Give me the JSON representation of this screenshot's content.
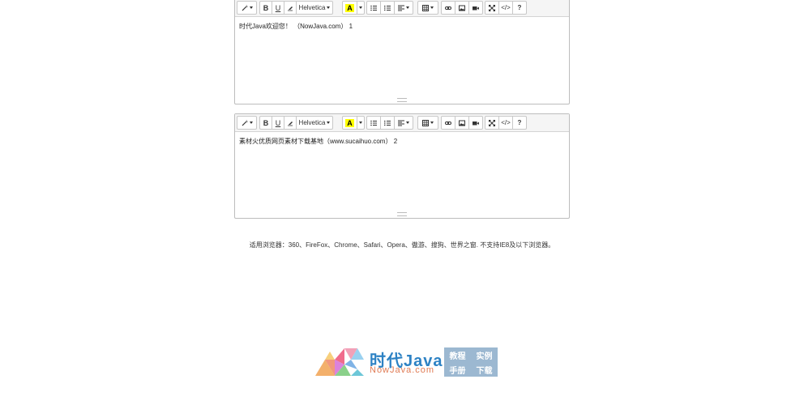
{
  "toolbar": {
    "font_name": "Helvetica",
    "highlight_letter": "A",
    "help_label": "?",
    "bold_label": "B",
    "underline_label": "U",
    "code_label": "</>"
  },
  "editors": [
    {
      "content": "时代Java欢迎您！ （NowJava.com） 1"
    },
    {
      "content": "素材火优质网页素材下载基地（www.sucaihuo.com） 2"
    }
  ],
  "footer": {
    "browsers_notice": "适用浏览器：360、FireFox、Chrome、Safari、Opera、傲游、搜狗、世界之窗. 不支持IE8及以下浏览器。"
  },
  "logo": {
    "title": "时代Java",
    "subtitle": "NowJava.com",
    "links": [
      "教程",
      "实例",
      "手册",
      "下载"
    ]
  },
  "icons": [
    "magic-wand-icon",
    "bold-icon",
    "underline-icon",
    "eraser-icon",
    "font-color-icon",
    "unordered-list-icon",
    "ordered-list-icon",
    "align-icon",
    "table-icon",
    "link-icon",
    "picture-icon",
    "video-icon",
    "fullscreen-icon",
    "code-view-icon",
    "help-icon"
  ],
  "colors": {
    "highlight": "#ffff00",
    "logo_blue": "#2d82c4",
    "logo_orange": "#e07b54",
    "logo_box": "#9cb8d1"
  }
}
